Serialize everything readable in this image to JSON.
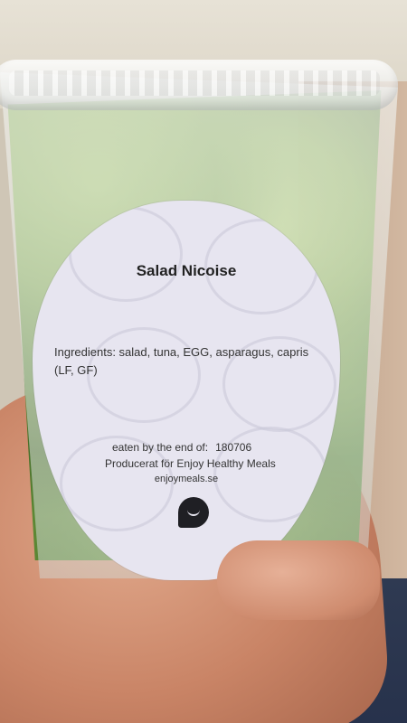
{
  "label": {
    "title": "Salad Nicoise",
    "ingredients": "Ingredients: salad, tuna, EGG, asparagus, capris (LF, GF)",
    "eaten_by_label": "eaten by the end of:",
    "eaten_by_date": "180706",
    "producer": "Producerat för Enjoy Healthy Meals",
    "website": "enjoymeals.se"
  }
}
